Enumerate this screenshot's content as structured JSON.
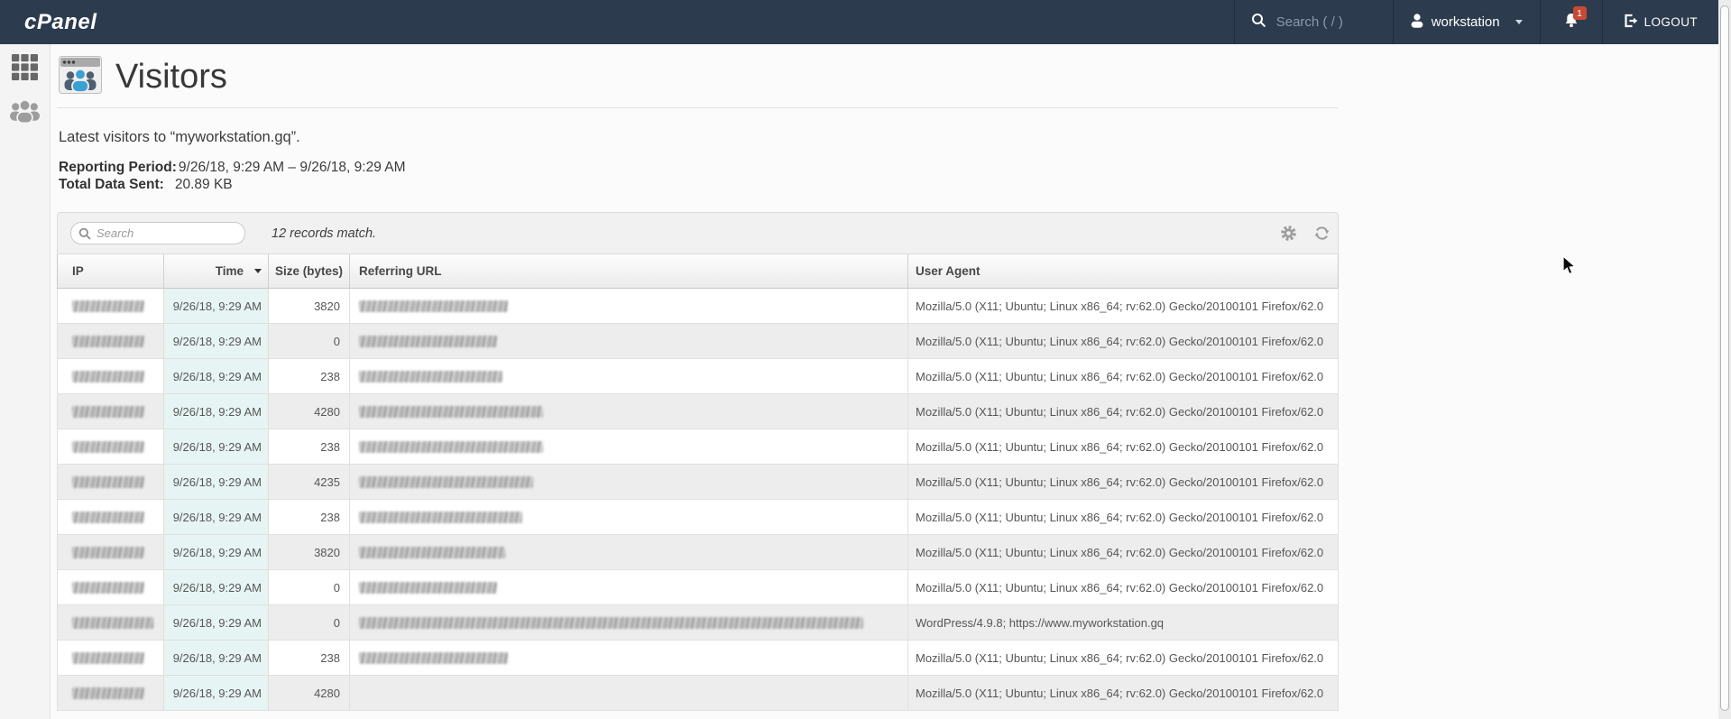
{
  "topbar": {
    "brand": "cPanel",
    "search_placeholder": "Search ( / )",
    "user": "workstation",
    "notification_count": "1",
    "logout_label": "LOGOUT"
  },
  "sidebar": {
    "items": [
      {
        "icon": "apps-grid-icon"
      },
      {
        "icon": "user-manager-icon"
      }
    ]
  },
  "page": {
    "title": "Visitors",
    "intro": "Latest visitors to “myworkstation.gq”.",
    "reporting_period_label": "Reporting Period:",
    "reporting_period_value": "9/26/18, 9:29 AM  –  9/26/18, 9:29 AM",
    "total_data_label": "Total Data Sent:",
    "total_data_value": "20.89 KB"
  },
  "toolbar": {
    "search_placeholder": "Search",
    "records_text": "12 records match."
  },
  "table": {
    "columns": [
      "IP",
      "Time",
      "Size (bytes)",
      "Referring URL",
      "User Agent"
    ],
    "sorted_column": "Time",
    "sort_direction": "desc",
    "default_ip_blur_width": 80,
    "rows": [
      {
        "ip_redacted": true,
        "time": "9/26/18, 9:29 AM",
        "size": "3820",
        "referring_url_redacted": true,
        "ref_blur_width": 165,
        "user_agent": "Mozilla/5.0 (X11; Ubuntu; Linux x86_64; rv:62.0) Gecko/20100101 Firefox/62.0"
      },
      {
        "ip_redacted": true,
        "time": "9/26/18, 9:29 AM",
        "size": "0",
        "referring_url_redacted": true,
        "ref_blur_width": 153,
        "user_agent": "Mozilla/5.0 (X11; Ubuntu; Linux x86_64; rv:62.0) Gecko/20100101 Firefox/62.0"
      },
      {
        "ip_redacted": true,
        "time": "9/26/18, 9:29 AM",
        "size": "238",
        "referring_url_redacted": true,
        "ref_blur_width": 159,
        "user_agent": "Mozilla/5.0 (X11; Ubuntu; Linux x86_64; rv:62.0) Gecko/20100101 Firefox/62.0"
      },
      {
        "ip_redacted": true,
        "time": "9/26/18, 9:29 AM",
        "size": "4280",
        "referring_url_redacted": true,
        "ref_blur_width": 204,
        "user_agent": "Mozilla/5.0 (X11; Ubuntu; Linux x86_64; rv:62.0) Gecko/20100101 Firefox/62.0"
      },
      {
        "ip_redacted": true,
        "time": "9/26/18, 9:29 AM",
        "size": "238",
        "referring_url_redacted": true,
        "ref_blur_width": 204,
        "user_agent": "Mozilla/5.0 (X11; Ubuntu; Linux x86_64; rv:62.0) Gecko/20100101 Firefox/62.0"
      },
      {
        "ip_redacted": true,
        "time": "9/26/18, 9:29 AM",
        "size": "4235",
        "referring_url_redacted": true,
        "ref_blur_width": 193,
        "user_agent": "Mozilla/5.0 (X11; Ubuntu; Linux x86_64; rv:62.0) Gecko/20100101 Firefox/62.0"
      },
      {
        "ip_redacted": true,
        "time": "9/26/18, 9:29 AM",
        "size": "238",
        "referring_url_redacted": true,
        "ref_blur_width": 181,
        "user_agent": "Mozilla/5.0 (X11; Ubuntu; Linux x86_64; rv:62.0) Gecko/20100101 Firefox/62.0"
      },
      {
        "ip_redacted": true,
        "time": "9/26/18, 9:29 AM",
        "size": "3820",
        "referring_url_redacted": true,
        "ref_blur_width": 162,
        "user_agent": "Mozilla/5.0 (X11; Ubuntu; Linux x86_64; rv:62.0) Gecko/20100101 Firefox/62.0"
      },
      {
        "ip_redacted": true,
        "time": "9/26/18, 9:29 AM",
        "size": "0",
        "referring_url_redacted": true,
        "ref_blur_width": 153,
        "user_agent": "Mozilla/5.0 (X11; Ubuntu; Linux x86_64; rv:62.0) Gecko/20100101 Firefox/62.0"
      },
      {
        "ip_redacted": true,
        "ip_blur_width": 90,
        "time": "9/26/18, 9:29 AM",
        "size": "0",
        "referring_url_redacted": true,
        "ref_blur_width": 559,
        "user_agent": "WordPress/4.9.8; https://www.myworkstation.gq"
      },
      {
        "ip_redacted": true,
        "time": "9/26/18, 9:29 AM",
        "size": "238",
        "referring_url_redacted": true,
        "ref_blur_width": 165,
        "user_agent": "Mozilla/5.0 (X11; Ubuntu; Linux x86_64; rv:62.0) Gecko/20100101 Firefox/62.0"
      },
      {
        "ip_redacted": true,
        "time": "9/26/18, 9:29 AM",
        "size": "4280",
        "referring_url_redacted": false,
        "ref_blur_width": 0,
        "user_agent": "Mozilla/5.0 (X11; Ubuntu; Linux x86_64; rv:62.0) Gecko/20100101 Firefox/62.0"
      }
    ]
  },
  "colors": {
    "topbar_bg": "#2c3c4e",
    "badge": "#c74a34",
    "time_cell_bg": "#e7f4f4",
    "accent_blue": "#3ba0d4"
  }
}
